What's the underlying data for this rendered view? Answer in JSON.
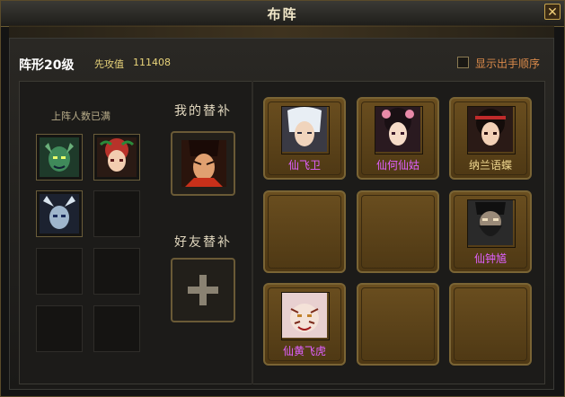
{
  "window": {
    "title": "布阵",
    "close_label": "✕"
  },
  "info": {
    "formation": "阵形20级",
    "attack_label": "先攻值",
    "attack_value": "111408"
  },
  "options": {
    "show_order_label": "显示出手顺序",
    "show_order_checked": false
  },
  "roster": {
    "status": "上阵人数已满",
    "slots": [
      {
        "filled": true,
        "icon": "green-monster-portrait"
      },
      {
        "filled": true,
        "icon": "red-hair-girl-portrait"
      },
      {
        "filled": true,
        "icon": "blue-ghost-portrait"
      },
      {
        "filled": false
      },
      {
        "filled": false
      },
      {
        "filled": false
      },
      {
        "filled": false
      },
      {
        "filled": false
      }
    ]
  },
  "substitutes": {
    "my_title": "我的替补",
    "friend_title": "好友替补",
    "my_sub_icon": "red-warrior-portrait",
    "friend_icon": "plus-icon"
  },
  "grid": [
    {
      "name": "仙飞卫",
      "color": "purple",
      "icon": "white-hair-warrior-portrait"
    },
    {
      "name": "仙何仙姑",
      "color": "purple",
      "icon": "fairy-girl-portrait"
    },
    {
      "name": "纳兰语蝶",
      "color": "yellow",
      "icon": "dark-hair-girl-portrait"
    },
    {
      "name": ""
    },
    {
      "name": ""
    },
    {
      "name": "仙钟馗",
      "color": "purple",
      "icon": "bearded-warrior-portrait"
    },
    {
      "name": "仙黄飞虎",
      "color": "purple",
      "icon": "tiger-warrior-portrait"
    },
    {
      "name": ""
    },
    {
      "name": ""
    }
  ],
  "colors": {
    "purple_name": "#e060ff",
    "yellow_name": "#f0d890",
    "cell_gold": "#7a6434"
  }
}
